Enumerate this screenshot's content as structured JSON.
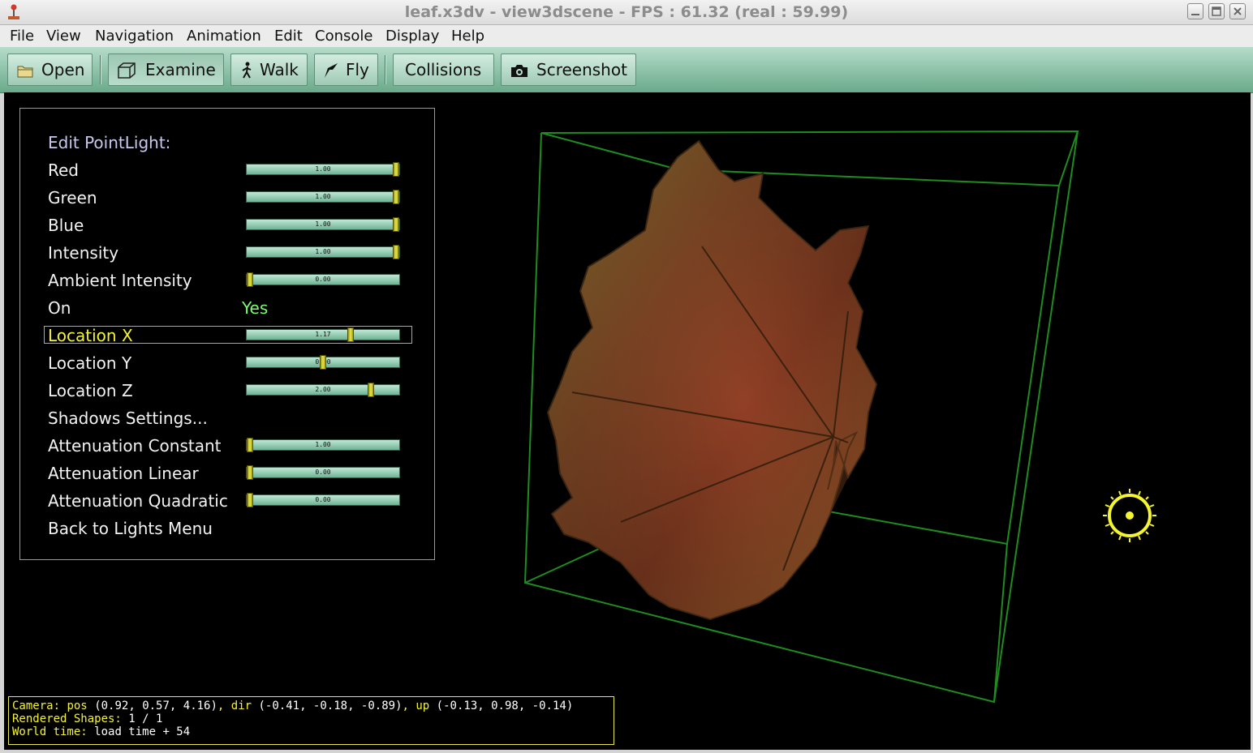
{
  "window": {
    "title": "leaf.x3dv - view3dscene - FPS : 61.32 (real : 59.99)",
    "icon": "joystick-icon",
    "buttons": [
      "minimize-icon",
      "maximize-icon",
      "close-icon"
    ]
  },
  "menu": [
    "File",
    "View",
    "Navigation",
    "Animation",
    "Edit",
    "Console",
    "Display",
    "Help"
  ],
  "toolbar": {
    "open": "Open",
    "examine": "Examine",
    "walk": "Walk",
    "fly": "Fly",
    "collisions": "Collisions",
    "screenshot": "Screenshot",
    "active_mode": "Examine"
  },
  "panel": {
    "header": "Edit PointLight:",
    "items": [
      {
        "label": "Red",
        "slider": {
          "value": "1.00",
          "min": 0,
          "max": 1,
          "pos": 1.0
        }
      },
      {
        "label": "Green",
        "slider": {
          "value": "1.00",
          "min": 0,
          "max": 1,
          "pos": 1.0
        }
      },
      {
        "label": "Blue",
        "slider": {
          "value": "1.00",
          "min": 0,
          "max": 1,
          "pos": 1.0
        }
      },
      {
        "label": "Intensity",
        "slider": {
          "value": "1.00",
          "min": 0,
          "max": 1,
          "pos": 1.0
        }
      },
      {
        "label": "Ambient Intensity",
        "slider": {
          "value": "0.00",
          "min": 0,
          "max": 1,
          "pos": 0.0
        }
      },
      {
        "label": "On",
        "value": "Yes"
      },
      {
        "label": "Location X",
        "selected": true,
        "slider": {
          "value": "1.17",
          "pos": 0.69
        }
      },
      {
        "label": "Location Y",
        "slider": {
          "value": "0.00",
          "pos": 0.5
        }
      },
      {
        "label": "Location Z",
        "slider": {
          "value": "2.00",
          "pos": 0.83
        }
      },
      {
        "label": "Shadows Settings..."
      },
      {
        "label": "Attenuation Constant",
        "slider": {
          "value": "1.00",
          "pos": 0.0
        }
      },
      {
        "label": "Attenuation Linear",
        "slider": {
          "value": "0.00",
          "pos": 0.0
        }
      },
      {
        "label": "Attenuation Quadratic",
        "slider": {
          "value": "0.00",
          "pos": 0.0
        }
      },
      {
        "label": "Back to Lights Menu"
      }
    ]
  },
  "status": {
    "camera_label": "Camera:",
    "pos_label": "pos",
    "pos_value": "(0.92, 0.57, 4.16)",
    "dir_label": "dir",
    "dir_value": "(-0.41, -0.18, -0.89)",
    "up_label": "up",
    "up_value": "(-0.13, 0.98, -0.14)",
    "shapes_label": "Rendered Shapes:",
    "shapes_value": "1 / 1",
    "time_label": "World time:",
    "time_value": "load time + 54"
  },
  "colors": {
    "toolbar": "#8cc6aa",
    "bbox": "#1e8c1e",
    "highlight": "#f4f430",
    "on_value": "#7cfc6c"
  }
}
